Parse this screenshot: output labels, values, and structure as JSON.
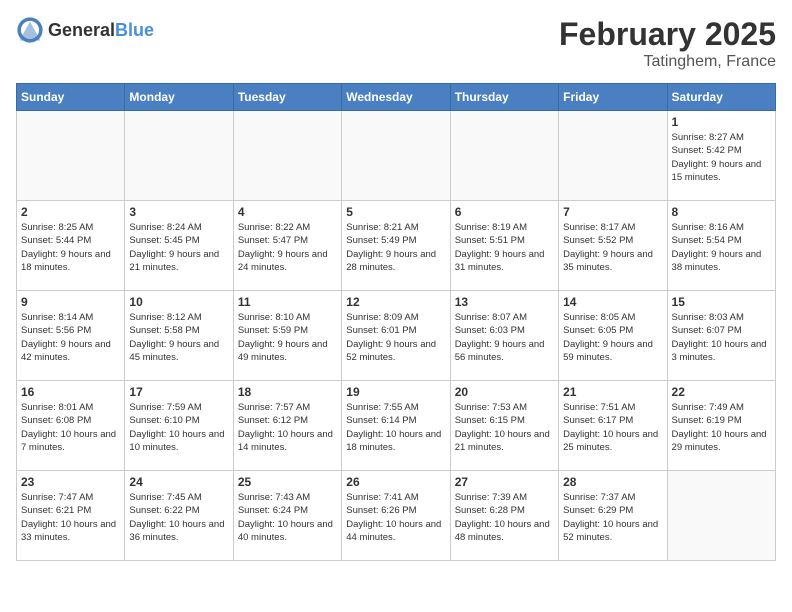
{
  "header": {
    "logo_general": "General",
    "logo_blue": "Blue",
    "month_year": "February 2025",
    "location": "Tatinghem, France"
  },
  "days_of_week": [
    "Sunday",
    "Monday",
    "Tuesday",
    "Wednesday",
    "Thursday",
    "Friday",
    "Saturday"
  ],
  "weeks": [
    [
      {
        "day": "",
        "info": ""
      },
      {
        "day": "",
        "info": ""
      },
      {
        "day": "",
        "info": ""
      },
      {
        "day": "",
        "info": ""
      },
      {
        "day": "",
        "info": ""
      },
      {
        "day": "",
        "info": ""
      },
      {
        "day": "1",
        "info": "Sunrise: 8:27 AM\nSunset: 5:42 PM\nDaylight: 9 hours and 15 minutes."
      }
    ],
    [
      {
        "day": "2",
        "info": "Sunrise: 8:25 AM\nSunset: 5:44 PM\nDaylight: 9 hours and 18 minutes."
      },
      {
        "day": "3",
        "info": "Sunrise: 8:24 AM\nSunset: 5:45 PM\nDaylight: 9 hours and 21 minutes."
      },
      {
        "day": "4",
        "info": "Sunrise: 8:22 AM\nSunset: 5:47 PM\nDaylight: 9 hours and 24 minutes."
      },
      {
        "day": "5",
        "info": "Sunrise: 8:21 AM\nSunset: 5:49 PM\nDaylight: 9 hours and 28 minutes."
      },
      {
        "day": "6",
        "info": "Sunrise: 8:19 AM\nSunset: 5:51 PM\nDaylight: 9 hours and 31 minutes."
      },
      {
        "day": "7",
        "info": "Sunrise: 8:17 AM\nSunset: 5:52 PM\nDaylight: 9 hours and 35 minutes."
      },
      {
        "day": "8",
        "info": "Sunrise: 8:16 AM\nSunset: 5:54 PM\nDaylight: 9 hours and 38 minutes."
      }
    ],
    [
      {
        "day": "9",
        "info": "Sunrise: 8:14 AM\nSunset: 5:56 PM\nDaylight: 9 hours and 42 minutes."
      },
      {
        "day": "10",
        "info": "Sunrise: 8:12 AM\nSunset: 5:58 PM\nDaylight: 9 hours and 45 minutes."
      },
      {
        "day": "11",
        "info": "Sunrise: 8:10 AM\nSunset: 5:59 PM\nDaylight: 9 hours and 49 minutes."
      },
      {
        "day": "12",
        "info": "Sunrise: 8:09 AM\nSunset: 6:01 PM\nDaylight: 9 hours and 52 minutes."
      },
      {
        "day": "13",
        "info": "Sunrise: 8:07 AM\nSunset: 6:03 PM\nDaylight: 9 hours and 56 minutes."
      },
      {
        "day": "14",
        "info": "Sunrise: 8:05 AM\nSunset: 6:05 PM\nDaylight: 9 hours and 59 minutes."
      },
      {
        "day": "15",
        "info": "Sunrise: 8:03 AM\nSunset: 6:07 PM\nDaylight: 10 hours and 3 minutes."
      }
    ],
    [
      {
        "day": "16",
        "info": "Sunrise: 8:01 AM\nSunset: 6:08 PM\nDaylight: 10 hours and 7 minutes."
      },
      {
        "day": "17",
        "info": "Sunrise: 7:59 AM\nSunset: 6:10 PM\nDaylight: 10 hours and 10 minutes."
      },
      {
        "day": "18",
        "info": "Sunrise: 7:57 AM\nSunset: 6:12 PM\nDaylight: 10 hours and 14 minutes."
      },
      {
        "day": "19",
        "info": "Sunrise: 7:55 AM\nSunset: 6:14 PM\nDaylight: 10 hours and 18 minutes."
      },
      {
        "day": "20",
        "info": "Sunrise: 7:53 AM\nSunset: 6:15 PM\nDaylight: 10 hours and 21 minutes."
      },
      {
        "day": "21",
        "info": "Sunrise: 7:51 AM\nSunset: 6:17 PM\nDaylight: 10 hours and 25 minutes."
      },
      {
        "day": "22",
        "info": "Sunrise: 7:49 AM\nSunset: 6:19 PM\nDaylight: 10 hours and 29 minutes."
      }
    ],
    [
      {
        "day": "23",
        "info": "Sunrise: 7:47 AM\nSunset: 6:21 PM\nDaylight: 10 hours and 33 minutes."
      },
      {
        "day": "24",
        "info": "Sunrise: 7:45 AM\nSunset: 6:22 PM\nDaylight: 10 hours and 36 minutes."
      },
      {
        "day": "25",
        "info": "Sunrise: 7:43 AM\nSunset: 6:24 PM\nDaylight: 10 hours and 40 minutes."
      },
      {
        "day": "26",
        "info": "Sunrise: 7:41 AM\nSunset: 6:26 PM\nDaylight: 10 hours and 44 minutes."
      },
      {
        "day": "27",
        "info": "Sunrise: 7:39 AM\nSunset: 6:28 PM\nDaylight: 10 hours and 48 minutes."
      },
      {
        "day": "28",
        "info": "Sunrise: 7:37 AM\nSunset: 6:29 PM\nDaylight: 10 hours and 52 minutes."
      },
      {
        "day": "",
        "info": ""
      }
    ]
  ]
}
